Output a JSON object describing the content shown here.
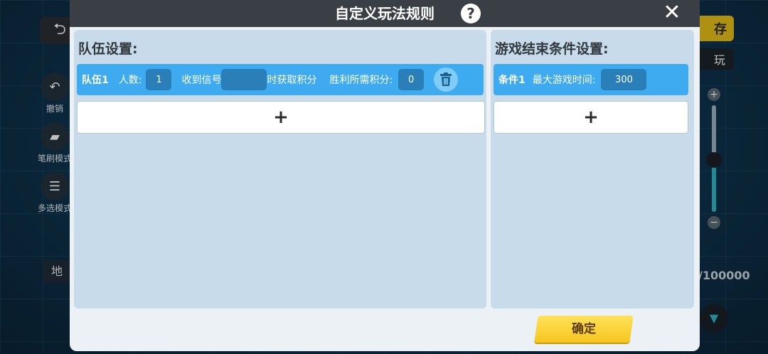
{
  "background": {
    "back_icon": "undo-arrow-icon",
    "tools": [
      {
        "label": "撤销",
        "icon": "undo-icon"
      },
      {
        "label": "笔刷模式",
        "icon": "brush-icon"
      },
      {
        "label": "多选模式",
        "icon": "checklist-icon"
      }
    ],
    "save_label": "存",
    "dark_button_label": "玩",
    "map_label": "地",
    "counter_text": "/100000"
  },
  "modal": {
    "title": "自定义玩法规则",
    "help_icon": "?",
    "close_icon": "✕",
    "left_panel": {
      "heading": "队伍设置:",
      "team": {
        "label": "队伍1",
        "people_label": "人数:",
        "people_value": "1",
        "signal_label": "收到信号",
        "signal_value": "",
        "score_suffix": "时获取积分",
        "win_label": "胜利所需积分:",
        "win_value": "0",
        "delete_icon": "trash-icon"
      },
      "add_label": "+"
    },
    "right_panel": {
      "heading": "游戏结束条件设置:",
      "condition": {
        "label": "条件1",
        "time_label": "最大游戏时间:",
        "time_value": "300"
      },
      "add_label": "+"
    },
    "confirm_label": "确定"
  },
  "colors": {
    "header": "#3a3f46",
    "panel": "#c7dbeb",
    "row": "#3eaaf0",
    "num_box": "#2a7fb8",
    "confirm": "#f6c51f"
  }
}
